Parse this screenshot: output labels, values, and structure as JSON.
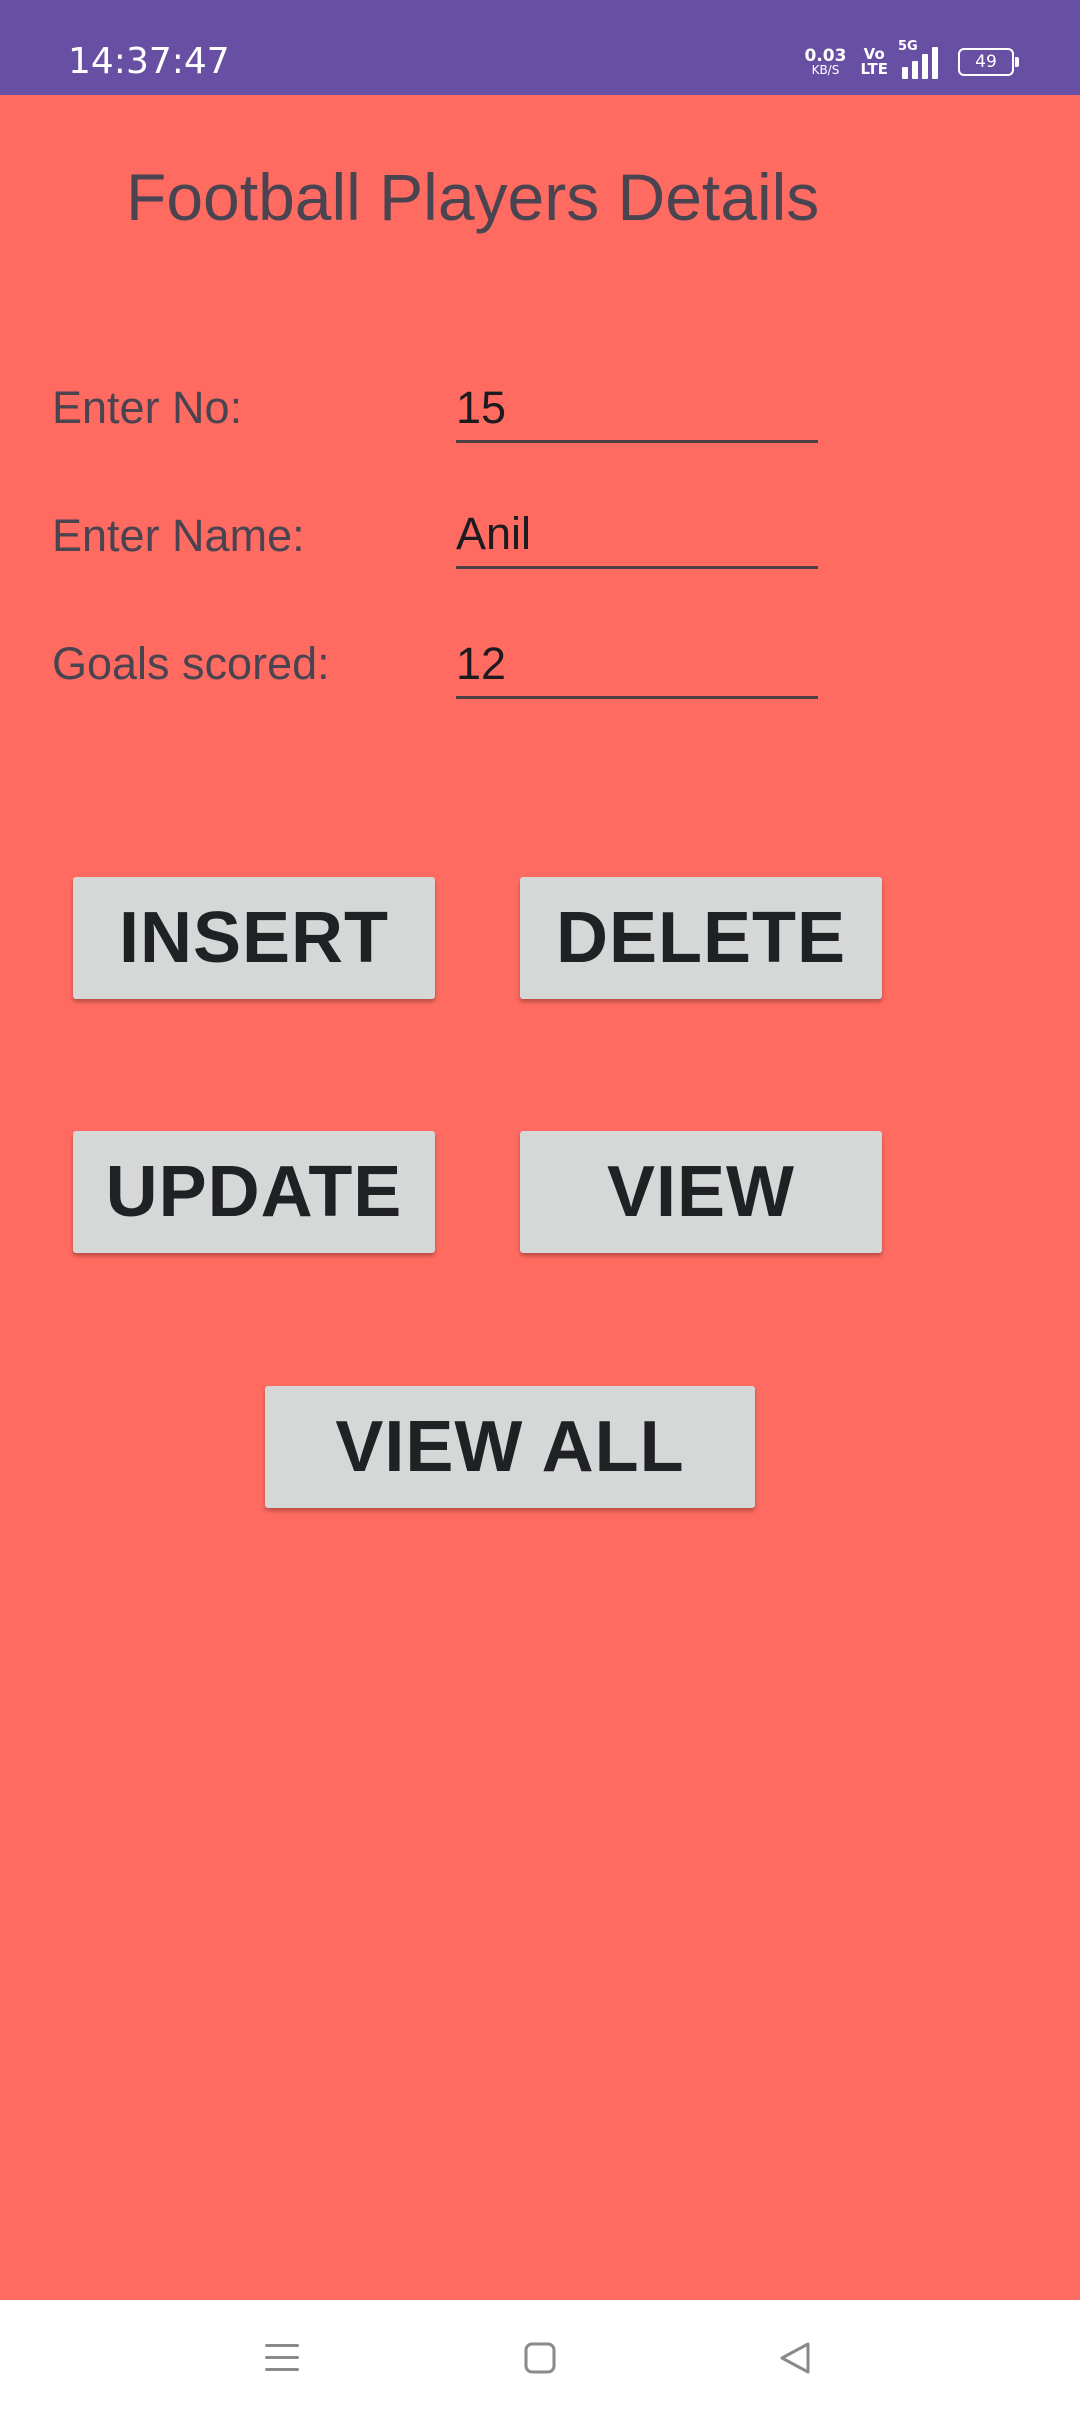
{
  "status_bar": {
    "time": "14:37:47",
    "net_speed": "0.03",
    "net_speed_unit": "KB/S",
    "volte_top": "Vo",
    "volte_bottom": "LTE",
    "network": "5G",
    "battery": "49",
    "icons": [
      "net-speed",
      "volte",
      "signal-5g",
      "battery"
    ]
  },
  "header": {
    "title": "Football Players Details"
  },
  "form": {
    "fields": [
      {
        "label": "Enter No:",
        "value": "15"
      },
      {
        "label": "Enter Name:",
        "value": "Anil"
      },
      {
        "label": "Goals scored:",
        "value": "12"
      }
    ]
  },
  "actions": {
    "insert": "INSERT",
    "delete": "DELETE",
    "update": "UPDATE",
    "view": "VIEW",
    "view_all": "VIEW ALL"
  },
  "nav_bar": {
    "icons": [
      "menu-icon",
      "home-icon",
      "back-icon"
    ]
  },
  "colors": {
    "status_bar": "#6750a4",
    "background": "#ff6b61",
    "button": "#d6d7d7",
    "text": "#4a4350"
  }
}
